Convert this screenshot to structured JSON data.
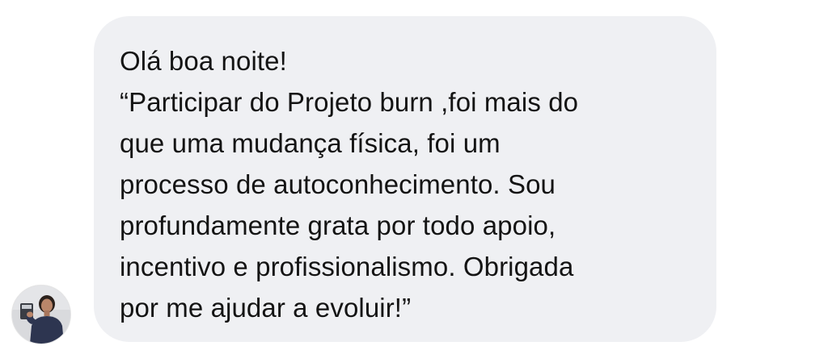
{
  "message": {
    "lines": [
      "Olá boa noite!",
      "“Participar do Projeto burn ,foi mais do",
      "que uma mudança física, foi um",
      "processo de autoconhecimento. Sou",
      "profundamente grata por todo apoio,",
      "incentivo e profissionalismo. Obrigada",
      "por me ajudar a evoluir!”"
    ]
  },
  "colors": {
    "bubble_background": "#eff0f3",
    "text": "#141414",
    "page_background": "#ffffff"
  },
  "avatar": {
    "icon": "user-photo-avatar"
  }
}
